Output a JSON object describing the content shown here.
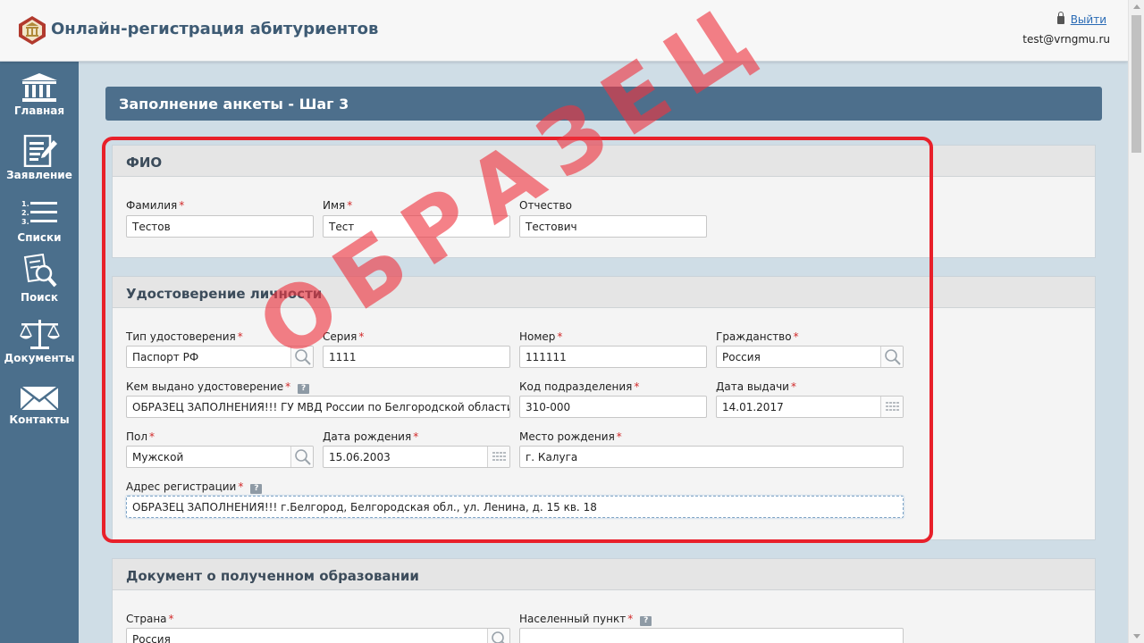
{
  "header": {
    "title": "Онлайн-регистрация абитуриентов",
    "logout_label": "Выйти",
    "user_email": "test@vrngmu.ru"
  },
  "sidebar": {
    "items": [
      {
        "label": "Главная",
        "icon": "bank-icon"
      },
      {
        "label": "Заявление",
        "icon": "edit-document-icon"
      },
      {
        "label": "Списки",
        "icon": "numbered-list-icon"
      },
      {
        "label": "Поиск",
        "icon": "document-search-icon"
      },
      {
        "label": "Документы",
        "icon": "scales-icon"
      },
      {
        "label": "Контакты",
        "icon": "envelope-icon"
      }
    ]
  },
  "page": {
    "step_title": "Заполнение анкеты - Шаг 3",
    "watermark": "ОБРАЗЕЦ"
  },
  "fio": {
    "title": "ФИО",
    "last_name_label": "Фамилия",
    "last_name": "Тестов",
    "first_name_label": "Имя",
    "first_name": "Тест",
    "patronymic_label": "Отчество",
    "patronymic": "Тестович"
  },
  "identity": {
    "title": "Удостоверение личности",
    "doc_type_label": "Тип удостоверения",
    "doc_type": "Паспорт РФ",
    "series_label": "Серия",
    "series": "1111",
    "number_label": "Номер",
    "number": "111111",
    "citizenship_label": "Гражданство",
    "citizenship": "Россия",
    "issued_by_label": "Кем выдано удостоверение",
    "issued_by": "ОБРАЗЕЦ ЗАПОЛНЕНИЯ!!! ГУ МВД России по Белгородской области",
    "dept_code_label": "Код подразделения",
    "dept_code": "310-000",
    "issue_date_label": "Дата выдачи",
    "issue_date": "14.01.2017",
    "gender_label": "Пол",
    "gender": "Мужской",
    "birth_date_label": "Дата рождения",
    "birth_date": "15.06.2003",
    "birth_place_label": "Место рождения",
    "birth_place": "г. Калуга",
    "address_label": "Адрес регистрации",
    "address": "ОБРАЗЕЦ ЗАПОЛНЕНИЯ!!! г.Белгород, Белгородская обл., ул. Ленина, д. 15 кв. 18"
  },
  "education": {
    "title": "Документ о полученном образовании",
    "country_label": "Страна",
    "country": "Россия",
    "locality_label": "Населенный пункт",
    "locality": ""
  },
  "colors": {
    "sidebar": "#4b6f8c",
    "step_bar": "#4d6f8c",
    "highlight": "#e8202a",
    "watermark": "#ef343f"
  }
}
